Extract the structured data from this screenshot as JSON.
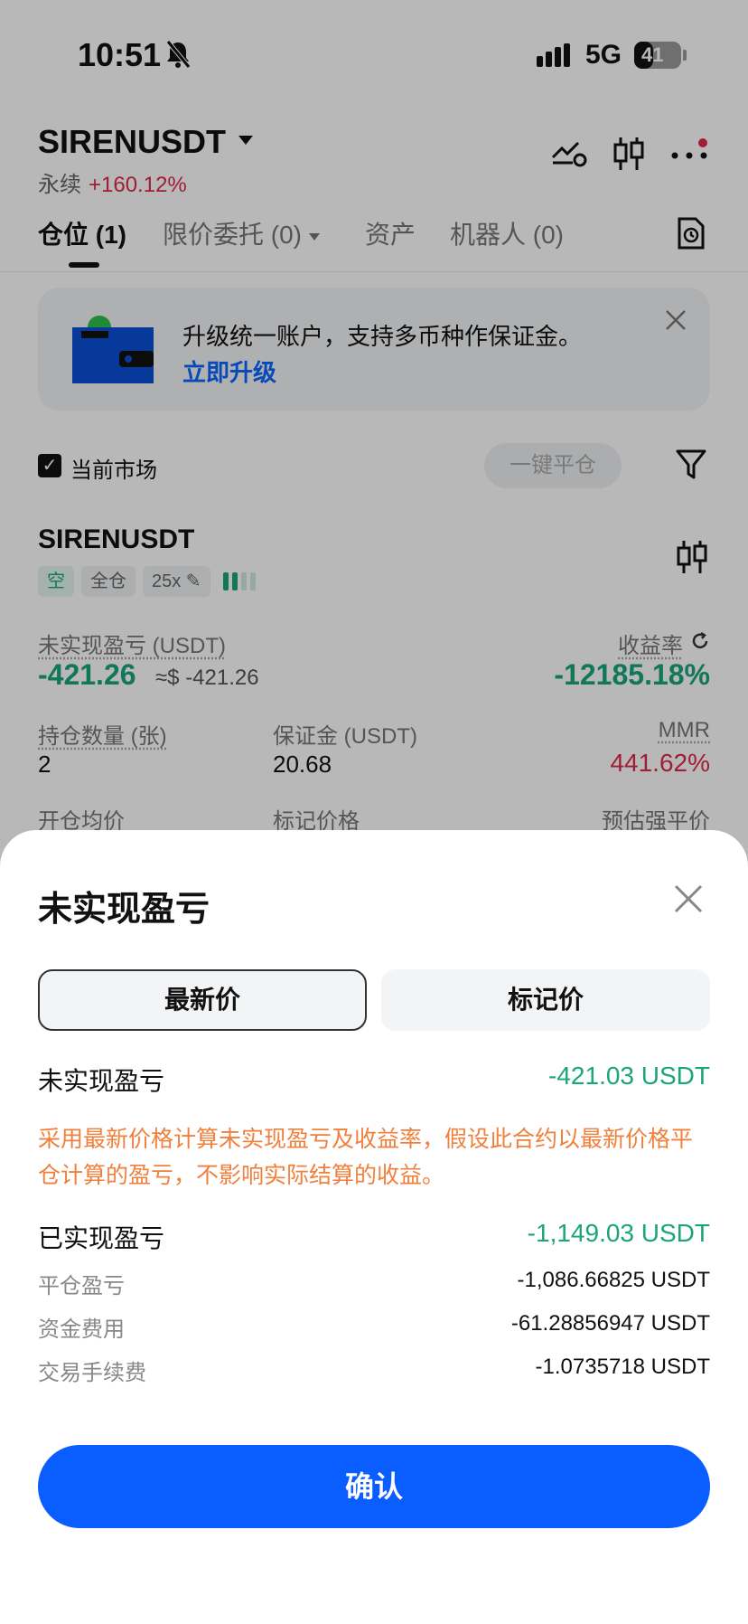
{
  "status_bar": {
    "time": "10:51",
    "network": "5G",
    "battery_level": "41",
    "battery_fraction": 0.41
  },
  "header": {
    "symbol": "SIRENUSDT",
    "contract_type": "永续",
    "change": "+160.12%"
  },
  "tabs": [
    {
      "label": "仓位 (1)",
      "active": true
    },
    {
      "label": "限价委托 (0)",
      "active": false
    },
    {
      "label": "资产",
      "active": false
    },
    {
      "label": "机器人 (0)",
      "active": false
    }
  ],
  "banner": {
    "text": "升级统一账户，支持多币种作保证金。",
    "link": "立即升级"
  },
  "filter_bar": {
    "current_market": "当前市场",
    "close_all": "一键平仓"
  },
  "position": {
    "symbol": "SIRENUSDT",
    "tags": {
      "side": "空",
      "margin_mode": "全仓",
      "leverage": "25x"
    },
    "unrealized_label": "未实现盈亏 (USDT)",
    "unrealized_value": "-421.26",
    "unrealized_approx": "≈$ -421.26",
    "roi_label": "收益率",
    "roi_value": "-12185.18%",
    "qty_label": "持仓数量 (张)",
    "qty_value": "2",
    "margin_label": "保证金 (USDT)",
    "margin_value": "20.68",
    "mmr_label": "MMR",
    "mmr_value": "441.62%",
    "open_price_label": "开仓均价",
    "mark_price_label": "标记价格",
    "liq_price_label": "预估强平价"
  },
  "sheet": {
    "title": "未实现盈亏",
    "segments": {
      "latest": "最新价",
      "mark": "标记价"
    },
    "unrealized_label": "未实现盈亏",
    "unrealized_value": "-421.03 USDT",
    "note": "采用最新价格计算未实现盈亏及收益率，假设此合约以最新价格平仓计算的盈亏，不影响实际结算的收益。",
    "realized_label": "已实现盈亏",
    "realized_value": "-1,149.03 USDT",
    "close_pnl_label": "平仓盈亏",
    "close_pnl_value": "-1,086.66825 USDT",
    "funding_label": "资金费用",
    "funding_value": "-61.28856947 USDT",
    "fee_label": "交易手续费",
    "fee_value": "-1.0735718 USDT",
    "confirm": "确认"
  },
  "colors": {
    "green": "#1aa57a",
    "red": "#e0294a",
    "blue": "#0a5dff",
    "orange": "#f0803c"
  }
}
